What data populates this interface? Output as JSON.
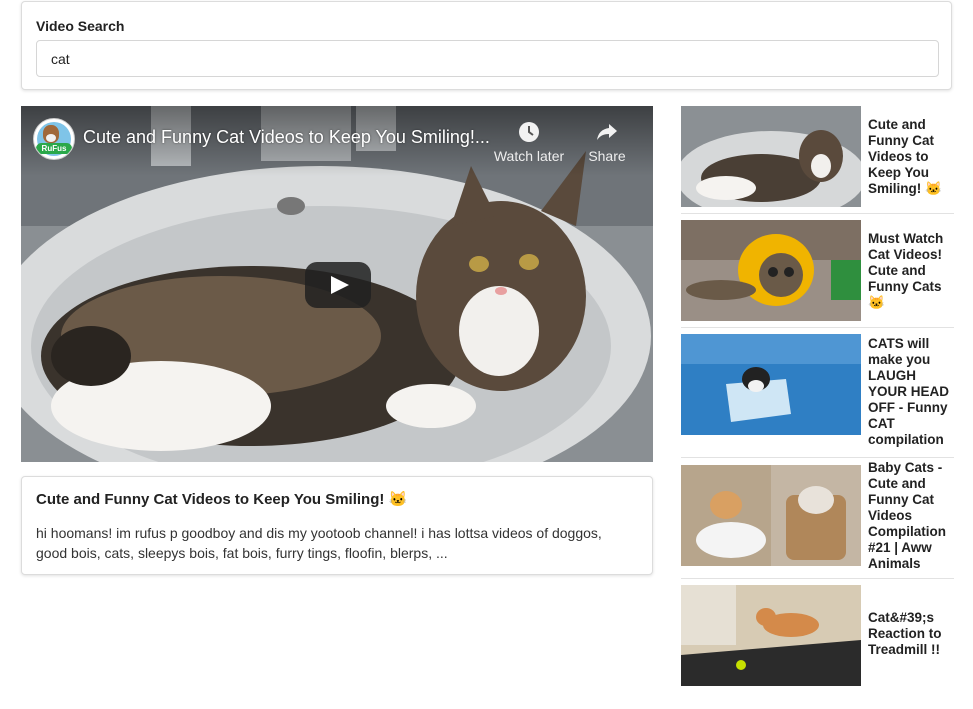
{
  "search": {
    "label": "Video Search",
    "value": "cat"
  },
  "player": {
    "title": "Cute and Funny Cat Videos to Keep You Smiling!...",
    "channel_badge": "RuFus",
    "watch_later_label": "Watch later",
    "share_label": "Share"
  },
  "selected": {
    "title": "Cute and Funny Cat Videos to Keep You Smiling! 🐱",
    "description": "hi hoomans! im rufus p goodboy and dis my yootoob channel! i has lottsa videos of doggos, good bois, cats, sleepys bois, fat bois, furry tings, floofin, blerps, ..."
  },
  "results": [
    {
      "title": "Cute and Funny Cat Videos to Keep You Smiling! 🐱"
    },
    {
      "title": "Must Watch Cat Videos! Cute and Funny Cats 🐱"
    },
    {
      "title": "CATS will make you LAUGH YOUR HEAD OFF - Funny CAT compilation"
    },
    {
      "title": "Baby Cats - Cute and Funny Cat Videos Compilation #21 | Aww Animals"
    },
    {
      "title": "Cat&#39;s Reaction to Treadmill !!"
    }
  ]
}
